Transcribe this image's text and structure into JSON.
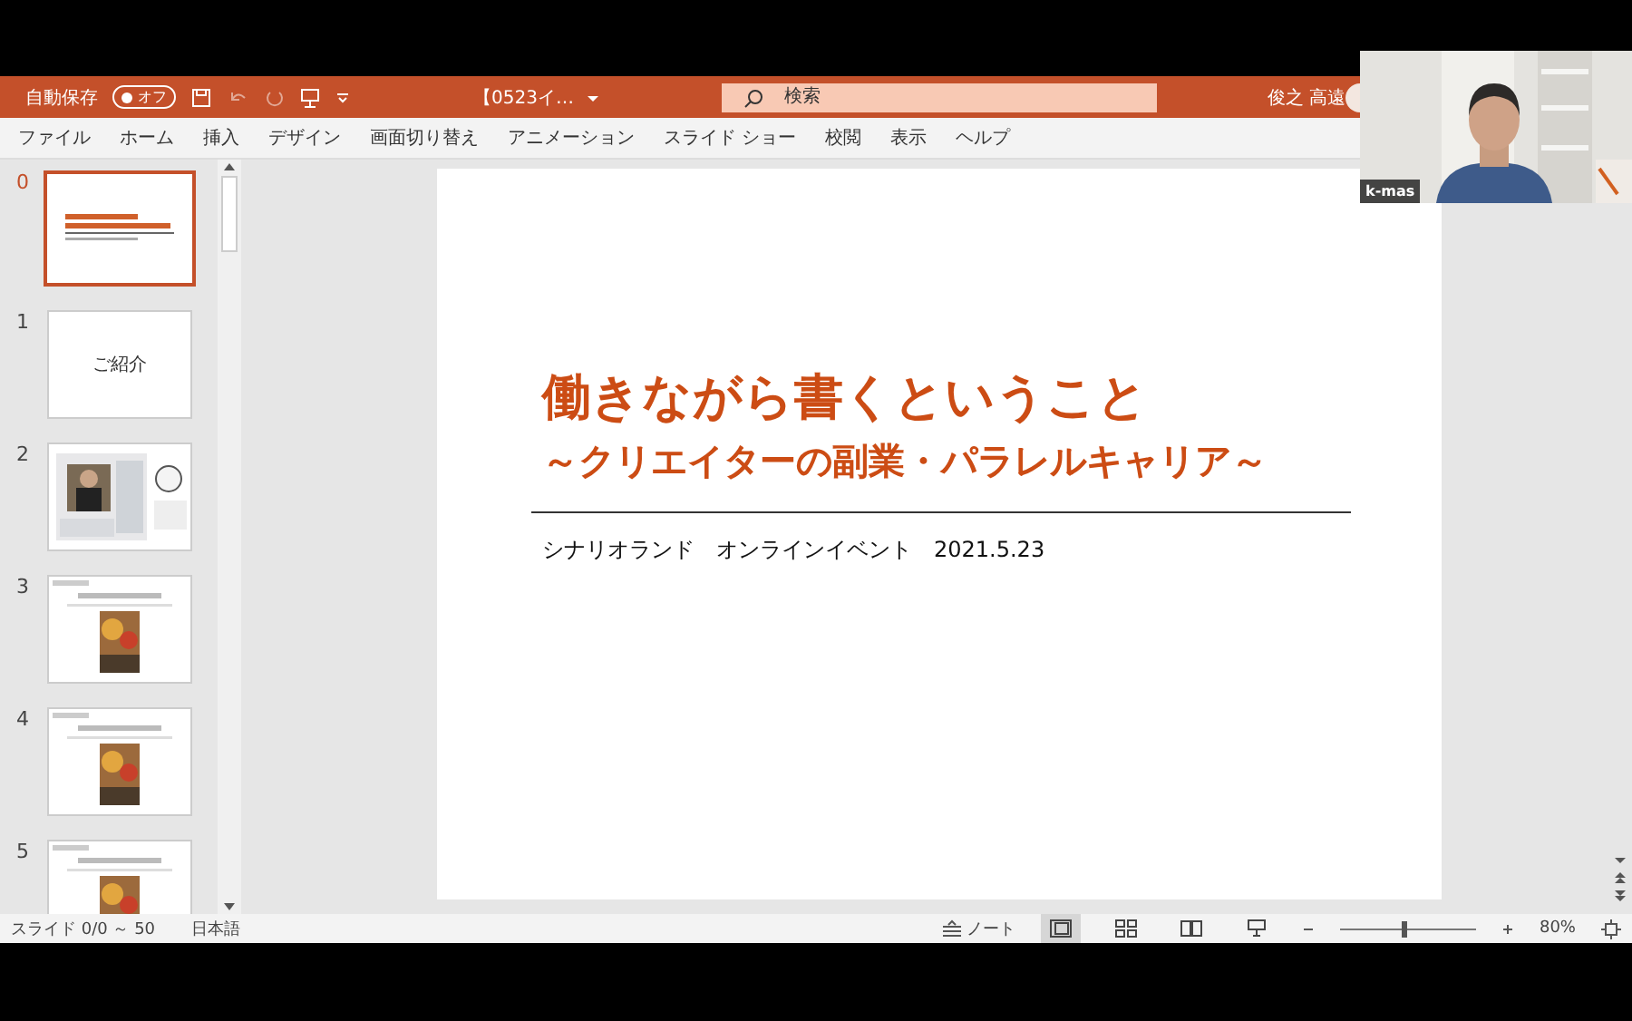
{
  "title_bar": {
    "autosave_label": "自動保存",
    "autosave_toggle": {
      "label": "オフ",
      "on": false
    },
    "document_title": "【0523イ…",
    "search": {
      "placeholder": "検索"
    },
    "user_name": "俊之 高遠"
  },
  "menu": [
    {
      "label": "ファイル"
    },
    {
      "label": "ホーム"
    },
    {
      "label": "挿入"
    },
    {
      "label": "デザイン"
    },
    {
      "label": "画面切り替え"
    },
    {
      "label": "アニメーション"
    },
    {
      "label": "スライド ショー"
    },
    {
      "label": "校閲"
    },
    {
      "label": "表示"
    },
    {
      "label": "ヘルプ"
    }
  ],
  "slides": [
    {
      "number": "0",
      "selected": true,
      "kind": "title"
    },
    {
      "number": "1",
      "selected": false,
      "kind": "text",
      "text": "ご紹介"
    },
    {
      "number": "2",
      "selected": false,
      "kind": "collage"
    },
    {
      "number": "3",
      "selected": false,
      "kind": "photo-page"
    },
    {
      "number": "4",
      "selected": false,
      "kind": "photo-page"
    },
    {
      "number": "5",
      "selected": false,
      "kind": "photo-page"
    }
  ],
  "slide": {
    "title": "働きながら書くということ",
    "subtitle": "～クリエイターの副業・パラレルキャリア～",
    "caption": "シナリオランド　オンラインイベント　2021.5.23"
  },
  "video": {
    "name": "k-mas"
  },
  "status_bar": {
    "slide_count": "スライド 0/0 ～ 50",
    "language": "日本語",
    "notes": "ノート",
    "zoom": {
      "level": 0.47,
      "value": "80%"
    }
  }
}
